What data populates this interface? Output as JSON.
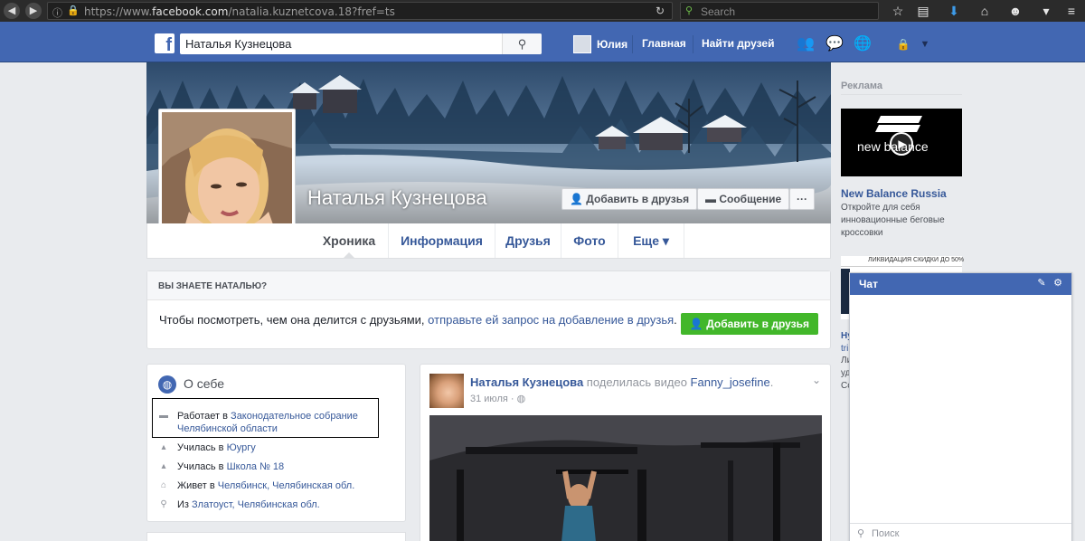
{
  "browser": {
    "url_prefix": "https://www.",
    "url_domain": "facebook.com",
    "url_path": "/natalia.kuznetcova.18?fref=ts",
    "search_placeholder": "Search"
  },
  "header": {
    "search_value": "Наталья Кузнецова",
    "profile_name": "Юлия",
    "home_label": "Главная",
    "find_friends_label": "Найти друзей"
  },
  "profile": {
    "name": "Наталья Кузнецова",
    "add_friend_label": "Добавить в друзья",
    "message_label": "Сообщение",
    "more_label": "···"
  },
  "tabs": [
    {
      "label": "Хроника"
    },
    {
      "label": "Информация"
    },
    {
      "label": "Друзья"
    },
    {
      "label": "Фото"
    },
    {
      "label": "Еще ▾"
    }
  ],
  "know_box": {
    "heading": "ВЫ ЗНАЕТЕ НАТАЛЬЮ?",
    "text_before": "Чтобы посмотреть, чем она делится с друзьями, ",
    "link": "отправьте ей запрос на добавление в друзья",
    "text_after": ".",
    "button_label": "Добавить в друзья"
  },
  "about": {
    "title": "О себе",
    "rows": [
      {
        "prefix": "Работает в ",
        "link": "Законодательное собрание Челябинской области"
      },
      {
        "prefix": "Училась в ",
        "link": "Юургу"
      },
      {
        "prefix": "Училась в ",
        "link": "Школа № 18"
      },
      {
        "prefix": "Живет в ",
        "link": "Челябинск, Челябинская обл."
      },
      {
        "prefix": "Из ",
        "link": "Златоуст, Челябинская обл."
      }
    ]
  },
  "post": {
    "author": "Наталья Кузнецова",
    "action": " поделилась видео ",
    "target": "Fanny_josefine",
    "period": ".",
    "date": "31 июля",
    "dot": " · "
  },
  "ads": {
    "label": "Реклама",
    "brand_text": "new balance",
    "title": "New Balance Russia",
    "description": "Откройте для себя инновационные беговые кроссовки",
    "ad2_banner": "ЛИКВИДАЦИЯ СКИДКИ ДО 50%",
    "ad2_frags": [
      "Hy",
      "tri",
      "Ли",
      "уд",
      "Со"
    ]
  },
  "chat": {
    "title": "Чат",
    "search_placeholder": "Поиск"
  },
  "colors": {
    "fb_blue": "#4267b2",
    "link": "#365899",
    "green": "#42b72a"
  }
}
